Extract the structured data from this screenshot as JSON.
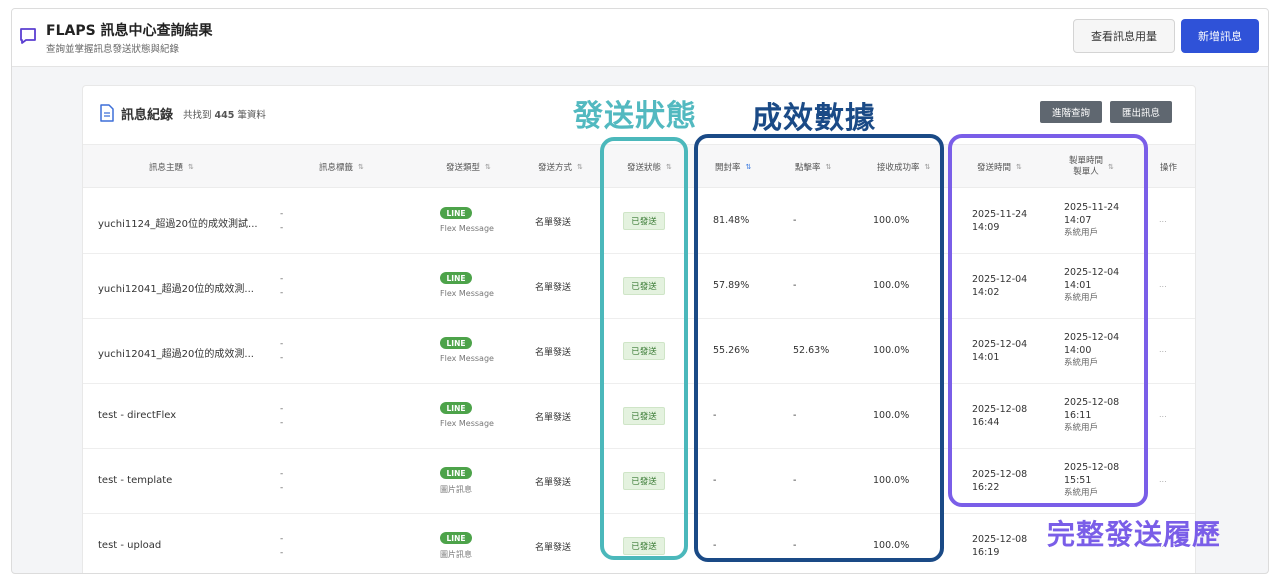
{
  "header": {
    "title": "FLAPS 訊息中心查詢結果",
    "subtitle": "查詢並掌握訊息發送狀態與紀錄",
    "usage_button": "查看訊息用量",
    "new_button": "新增訊息"
  },
  "panel": {
    "title": "訊息紀錄",
    "count_prefix": "共找到",
    "count": "445",
    "count_suffix": "筆資料",
    "advanced_button": "進階查詢",
    "export_button": "匯出訊息"
  },
  "columns": {
    "subject": "訊息主題",
    "tag": "訊息標籤",
    "send_type": "發送類型",
    "method": "發送方式",
    "status": "發送狀態",
    "open_rate": "開封率",
    "click_rate": "點擊率",
    "delivery_rate": "接收成功率",
    "send_time": "發送時間",
    "created_time": "製單時間",
    "creator": "製單人",
    "actions": "操作"
  },
  "rows": [
    {
      "subject": "yuchi1124_超過20位的成效測試...",
      "tag1": "-",
      "tag2": "-",
      "channel": "LINE",
      "msg_type": "Flex Message",
      "method": "名單發送",
      "status": "已發送",
      "open": "81.48%",
      "click": "-",
      "success": "100.0%",
      "send_date": "2025-11-24",
      "send_time": "14:09",
      "made_date": "2025-11-24",
      "made_time": "14:07",
      "creator": "系統用戶",
      "op": "..."
    },
    {
      "subject": "yuchi12041_超過20位的成效測...",
      "tag1": "-",
      "tag2": "-",
      "channel": "LINE",
      "msg_type": "Flex Message",
      "method": "名單發送",
      "status": "已發送",
      "open": "57.89%",
      "click": "-",
      "success": "100.0%",
      "send_date": "2025-12-04",
      "send_time": "14:02",
      "made_date": "2025-12-04",
      "made_time": "14:01",
      "creator": "系統用戶",
      "op": "..."
    },
    {
      "subject": "yuchi12041_超過20位的成效測...",
      "tag1": "-",
      "tag2": "-",
      "channel": "LINE",
      "msg_type": "Flex Message",
      "method": "名單發送",
      "status": "已發送",
      "open": "55.26%",
      "click": "52.63%",
      "success": "100.0%",
      "send_date": "2025-12-04",
      "send_time": "14:01",
      "made_date": "2025-12-04",
      "made_time": "14:00",
      "creator": "系統用戶",
      "op": "..."
    },
    {
      "subject": "test - directFlex",
      "tag1": "-",
      "tag2": "-",
      "channel": "LINE",
      "msg_type": "Flex Message",
      "method": "名單發送",
      "status": "已發送",
      "open": "-",
      "click": "-",
      "success": "100.0%",
      "send_date": "2025-12-08",
      "send_time": "16:44",
      "made_date": "2025-12-08",
      "made_time": "16:11",
      "creator": "系統用戶",
      "op": "..."
    },
    {
      "subject": "test - template",
      "tag1": "-",
      "tag2": "-",
      "channel": "LINE",
      "msg_type": "圖片訊息",
      "method": "名單發送",
      "status": "已發送",
      "open": "-",
      "click": "-",
      "success": "100.0%",
      "send_date": "2025-12-08",
      "send_time": "16:22",
      "made_date": "2025-12-08",
      "made_time": "15:51",
      "creator": "系統用戶",
      "op": "..."
    },
    {
      "subject": "test - upload",
      "tag1": "-",
      "tag2": "-",
      "channel": "LINE",
      "msg_type": "圖片訊息",
      "method": "名單發送",
      "status": "已發送",
      "open": "-",
      "click": "-",
      "success": "100.0%",
      "send_date": "2025-12-08",
      "send_time": "16:19",
      "made_date": "",
      "made_time": "",
      "creator": "",
      "op": "..."
    }
  ],
  "annotations": {
    "status_label": "發送狀態",
    "metrics_label": "成效數據",
    "history_label": "完整發送履歷"
  },
  "colors": {
    "primary": "#2f52d8",
    "teal": "#4bb8bb",
    "navy": "#1a4a86",
    "purple": "#7a5ee8",
    "line_green": "#4da34a"
  }
}
